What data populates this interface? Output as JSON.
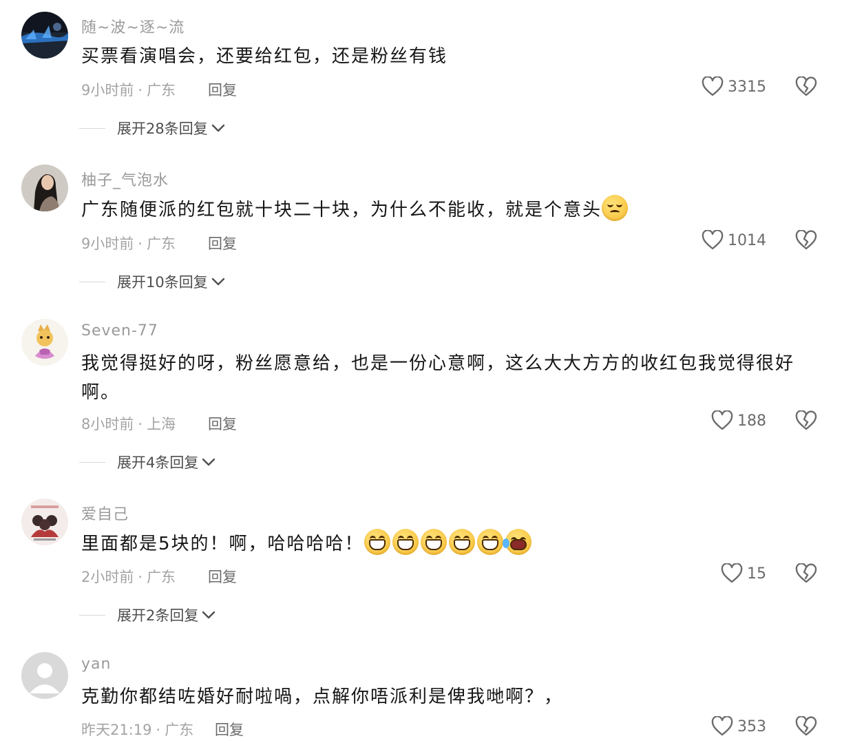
{
  "comments": [
    {
      "username": "随~波~逐~流",
      "text": "买票看演唱会，还要给红包，还是粉丝有钱",
      "emojis": [],
      "time": "9小时前",
      "location": "广东",
      "reply_label": "回复",
      "likes": "3315",
      "expand_label": "展开28条回复",
      "avatar": "city-night"
    },
    {
      "username": "柚子_气泡水",
      "text": "广东随便派的红包就十块二十块，为什么不能收，就是个意头",
      "emojis": [
        "worried-face-emoji"
      ],
      "time": "9小时前",
      "location": "广东",
      "reply_label": "回复",
      "likes": "1014",
      "expand_label": "展开10条回复",
      "avatar": "girl-portrait"
    },
    {
      "username": "Seven-77",
      "text": "我觉得挺好的呀，粉丝愿意给，也是一份心意啊，这么大大方方的收红包我觉得很好啊。",
      "emojis": [],
      "time": "8小时前",
      "location": "上海",
      "reply_label": "回复",
      "likes": "188",
      "expand_label": "展开4条回复",
      "avatar": "cartoon-cat"
    },
    {
      "username": "爱自己",
      "text": "里面都是5块的！啊，哈哈哈哈！",
      "emojis": [
        "grin-emoji",
        "grin-emoji",
        "grin-emoji",
        "grin-emoji",
        "grin-emoji",
        "laugh-cry-emoji"
      ],
      "time": "2小时前",
      "location": "广东",
      "reply_label": "回复",
      "likes": "15",
      "expand_label": "展开2条回复",
      "avatar": "illustration-group"
    },
    {
      "username": "yan",
      "text": "克勤你都结咗婚好耐啦喎，点解你唔派利是俾我哋啊？，",
      "emojis": [],
      "time": "昨天21:19",
      "location": "广东",
      "reply_label": "回复",
      "likes": "353",
      "expand_label": "",
      "avatar": "default-user"
    }
  ],
  "icons": {
    "like": "heart-outline-icon",
    "dislike": "broken-heart-icon",
    "expand": "chevron-down-icon"
  },
  "colors": {
    "text": "#161616",
    "secondary": "#9a9a9a",
    "icon": "#6b6b6b"
  }
}
